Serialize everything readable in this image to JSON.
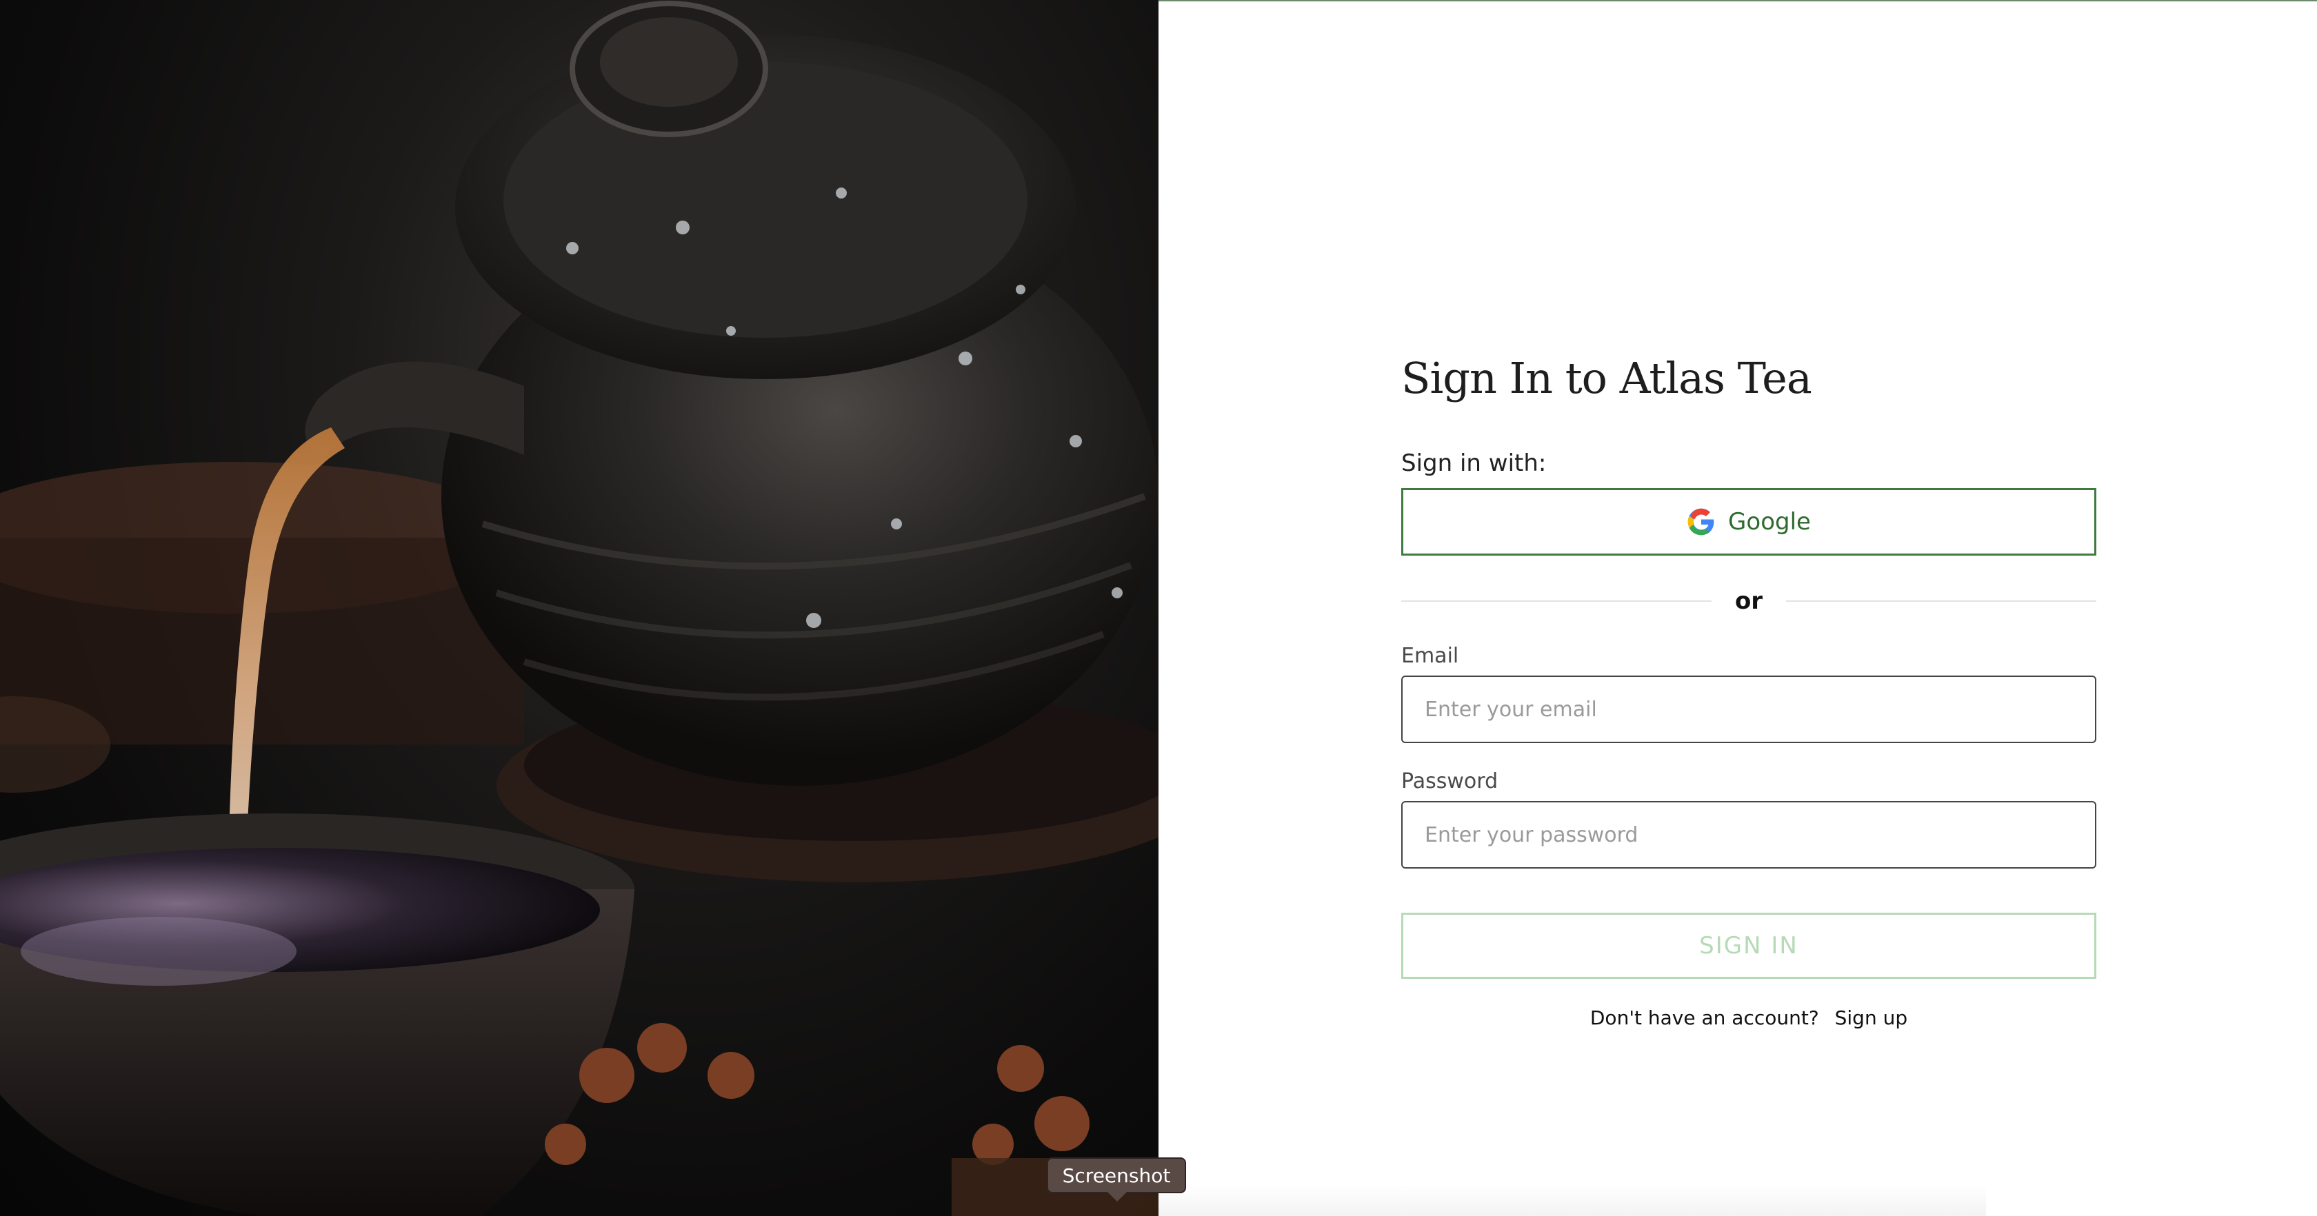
{
  "hero": {
    "image_description": "teapot-pouring-tea-photo"
  },
  "form": {
    "title": "Sign In to Atlas Tea",
    "signin_with": "Sign in with:",
    "google_label": "Google",
    "divider_text": "or",
    "email_label": "Email",
    "email_placeholder": "Enter your email",
    "email_value": "",
    "password_label": "Password",
    "password_placeholder": "Enter your password",
    "password_value": "",
    "signin_button": "SIGN IN",
    "no_account_text": "Don't have an account?",
    "signup_link": "Sign up"
  },
  "tooltip": {
    "text": "Screenshot"
  },
  "colors": {
    "brand_green": "#3f7a3f",
    "disabled_green": "#b6dab6",
    "text_dark": "#1e1e1e"
  }
}
